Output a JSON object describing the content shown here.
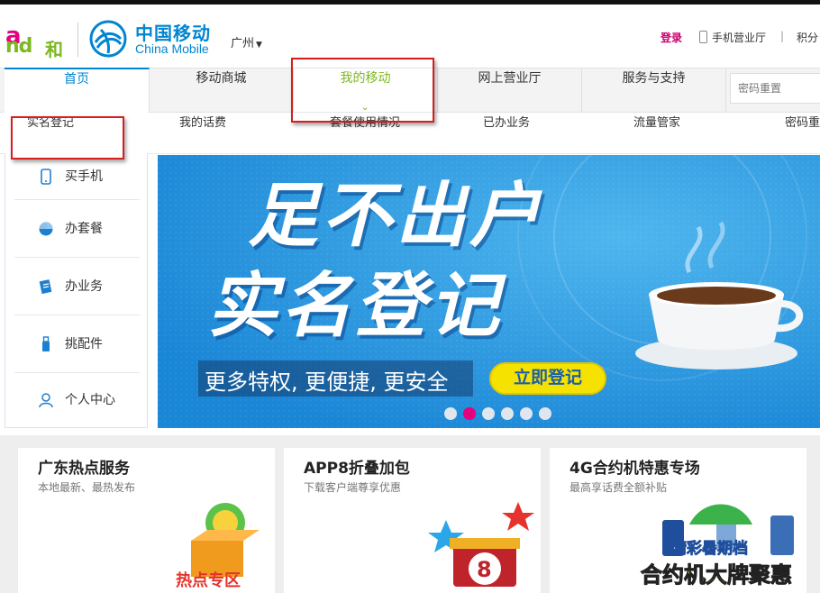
{
  "brand": {
    "and_logo_top": "a",
    "and_logo_bottom": "nd",
    "and_logo_he": "和",
    "cm_name_cn": "中国移动",
    "cm_name_en": "China Mobile",
    "city": "广州",
    "colors": {
      "blue": "#0085d0",
      "green": "#7cb820",
      "magenta": "#e6007e"
    }
  },
  "header_links": {
    "login": "登录",
    "mobile_hall": "手机营业厅",
    "separator": "|",
    "points": "积分"
  },
  "main_nav": {
    "items": [
      {
        "label": "首页"
      },
      {
        "label": "移动商城"
      },
      {
        "label": "我的移动"
      },
      {
        "label": "网上营业厅"
      },
      {
        "label": "服务与支持"
      }
    ],
    "active_chevron": "⌄",
    "search_placeholder": "密码重置"
  },
  "sub_nav": {
    "items": [
      {
        "label": "实名登记"
      },
      {
        "label": "我的话费"
      },
      {
        "label": "套餐使用情况"
      },
      {
        "label": "已办业务"
      },
      {
        "label": "流量管家"
      },
      {
        "label": "密码重"
      }
    ]
  },
  "sidebar": {
    "items": [
      {
        "label": "买手机",
        "icon": "phone-icon"
      },
      {
        "label": "办套餐",
        "icon": "package-icon"
      },
      {
        "label": "办业务",
        "icon": "form-icon"
      },
      {
        "label": "挑配件",
        "icon": "usb-icon"
      },
      {
        "label": "个人中心",
        "icon": "person-icon"
      }
    ]
  },
  "banner": {
    "title_line1": "足不出户",
    "title_line2": "实名登记",
    "slogan": "更多特权, 更便捷, 更安全",
    "button": "立即登记",
    "slide_count": 6,
    "active_slide": 2
  },
  "cards": [
    {
      "title": "广东热点服务",
      "subtitle": "本地最新、最热发布",
      "art_text": "热点专区"
    },
    {
      "title": "APP8折叠加包",
      "subtitle": "下载客户端尊享优惠",
      "art_text": "8"
    },
    {
      "title": "4G合约机特惠专场",
      "subtitle": "最高享话费全额补贴",
      "art_text_1": "精彩暑期档",
      "art_text_2": "合约机大牌聚惠"
    }
  ]
}
